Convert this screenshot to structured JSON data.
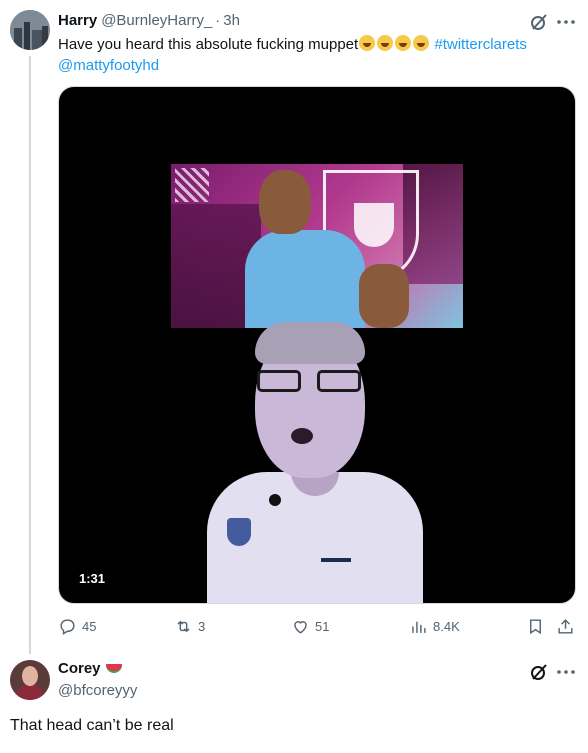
{
  "tweet": {
    "author_name": "Harry",
    "author_handle": "@BurnleyHarry_",
    "separator": "·",
    "time": "3h",
    "text_before_emoji": "Have you heard this absolute fucking muppet",
    "emojis": [
      "rolling-on-floor-laughing-emoji",
      "rolling-on-floor-laughing-emoji",
      "rolling-on-floor-laughing-emoji",
      "rolling-on-floor-laughing-emoji"
    ],
    "hashtag": "#twitterclarets",
    "mention": "@mattyfootyhd",
    "video_duration": "1:31",
    "actions": {
      "replies": "45",
      "reposts": "3",
      "likes": "51",
      "views": "8.4K"
    }
  },
  "reply": {
    "author_name": "Corey",
    "author_emoji": "watermelon-emoji",
    "author_handle": "@bfcoreyyy",
    "text": "That head can’t be real"
  },
  "colors": {
    "link": "#1d9bf0",
    "secondary_text": "#536471",
    "primary_text": "#0f1419",
    "border": "#cfd9de"
  }
}
